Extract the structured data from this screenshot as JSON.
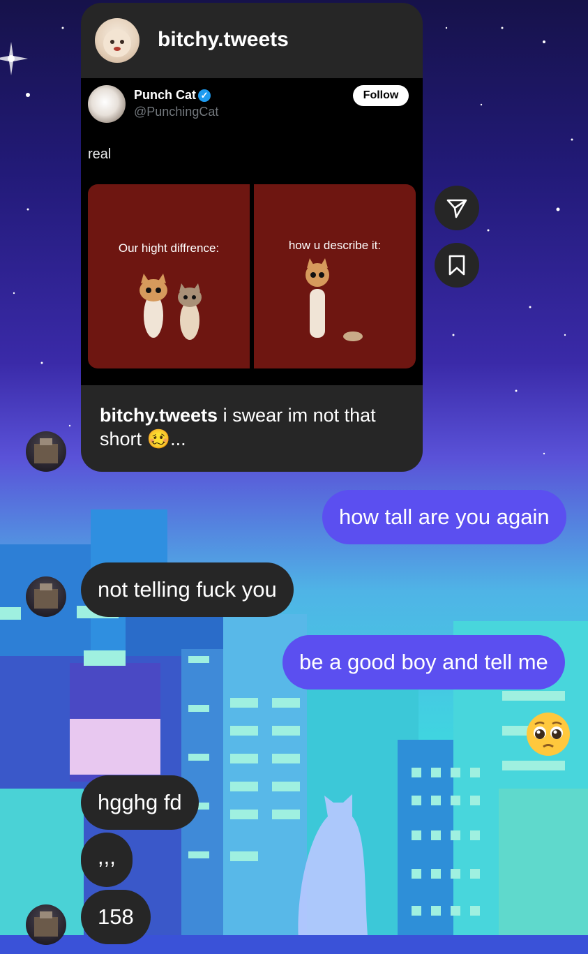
{
  "shared_post": {
    "account": "bitchy.tweets",
    "tweet": {
      "author_name": "Punch Cat",
      "author_handle": "@PunchingCat",
      "follow_label": "Follow",
      "text": "real",
      "panel_left_caption": "Our hight diffrence:",
      "panel_right_caption": "how u describe it:"
    },
    "caption_account": "bitchy.tweets",
    "caption_text": "i swear im not that short 🥴..."
  },
  "actions": {
    "share_icon": "send-icon",
    "save_icon": "bookmark-icon"
  },
  "messages": [
    {
      "direction": "out",
      "text": "how tall are you again"
    },
    {
      "direction": "in",
      "text": "not telling fuck you"
    },
    {
      "direction": "out",
      "text": "be a good boy and tell me"
    },
    {
      "direction": "out",
      "text": "🥺"
    },
    {
      "direction": "in",
      "text": "hgghg fd"
    },
    {
      "direction": "in",
      "text": ",,,"
    },
    {
      "direction": "in",
      "text": "158"
    }
  ],
  "colors": {
    "outgoing_bubble": "#5b4ff0",
    "incoming_bubble": "#262626",
    "verified_badge": "#1d9bf0",
    "meme_background": "#6e1611"
  }
}
